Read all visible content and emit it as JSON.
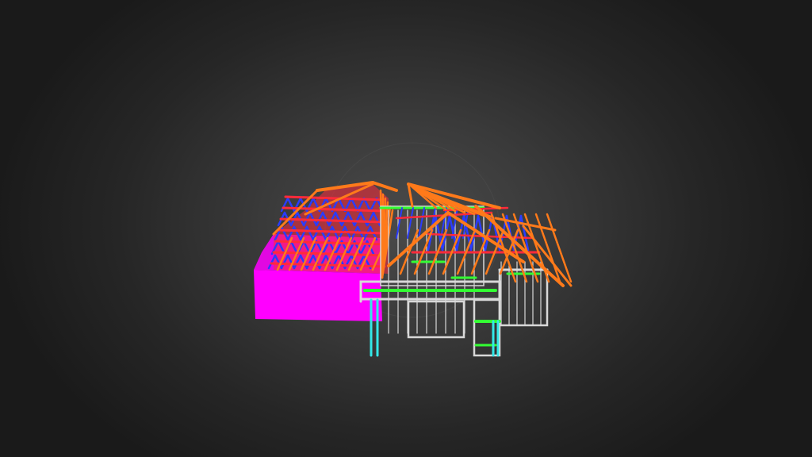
{
  "viewer": {
    "background_center": "#4a4a4a",
    "background_edge": "#1a1a1a"
  },
  "model": {
    "colors": {
      "wall_panel": "#ff00ff",
      "roof_rafter": "#ff7a1a",
      "roof_red": "#ff2a3a",
      "bracing_blue": "#2a3cff",
      "frame_white": "#d8d8d8",
      "frame_green": "#33ff33",
      "post_cyan": "#33e8e8"
    }
  }
}
